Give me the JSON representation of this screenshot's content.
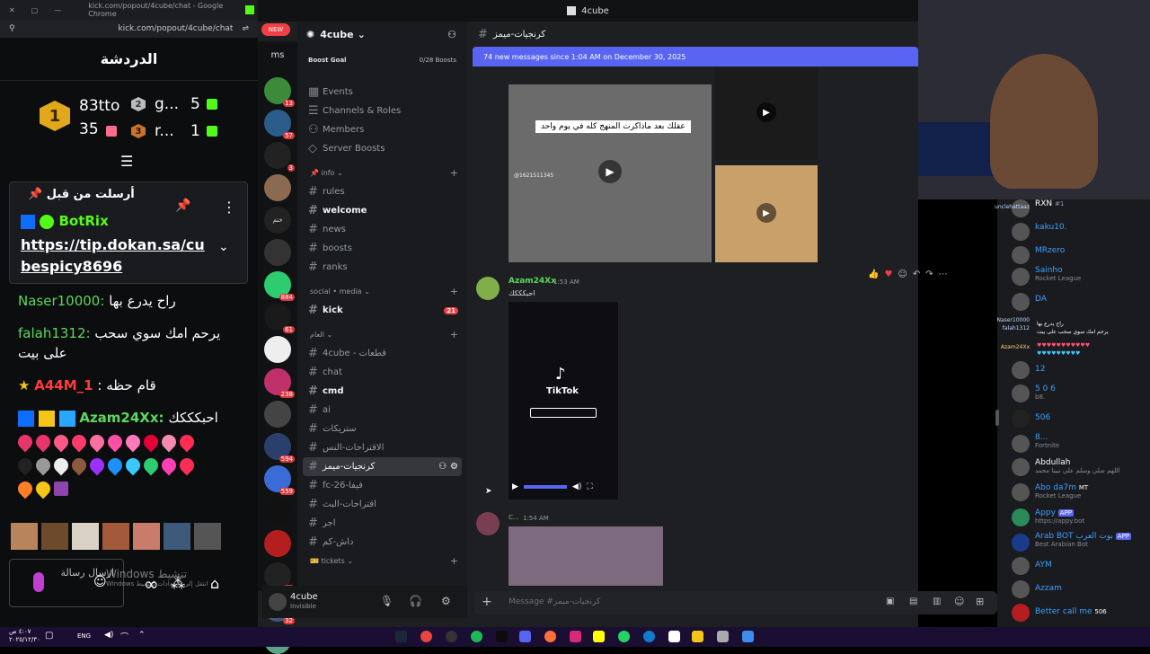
{
  "kick": {
    "window_title": "kick.com/popout/4cube/chat - Google Chrome",
    "url": "kick.com/popout/4cube/chat",
    "chat_title": "الدردشة",
    "leaderboard": [
      {
        "rank": "1",
        "name": "83tto",
        "count": ""
      },
      {
        "rank": "2",
        "name": "g...",
        "count": "5"
      },
      {
        "rank": "",
        "name": "",
        "count": "35"
      },
      {
        "rank": "3",
        "name": "r...",
        "count": "1"
      }
    ],
    "pinned": {
      "header": "أرسلت من قبل",
      "user": "BotRix",
      "link": "https://tip.dokan.sa/cubespicy8696"
    },
    "messages": [
      {
        "user": "Naser10000:",
        "text": "راح يدرع بها",
        "color": "#5bd85b"
      },
      {
        "user": "falah1312:",
        "text": "يرحم امك سوي سحب على بيت",
        "color": "#5bd85b"
      },
      {
        "user": "A44M_1",
        "text": ": قام حظه",
        "color": "#ff3b3b"
      },
      {
        "user": "Azam24Xx:",
        "text": "احبكككك",
        "color": "#5bd85b"
      }
    ],
    "send_label": "ارسال رسالة",
    "windows_watermark": "Windows تنشيط",
    "windows_sub": "Windows انتقل إلى الإعدادات لتنشيط"
  },
  "discord": {
    "top_title": "4cube",
    "server_name": "4cube",
    "new_badge": "NEW",
    "ms_label": "ms",
    "boost_goal": "Boost Goal",
    "boosts": "0/28 Boosts",
    "menu": [
      "Events",
      "Channels & Roles",
      "Members",
      "Server Boosts"
    ],
    "server_badges": [
      "13",
      "57",
      "3",
      "",
      "",
      "",
      "",
      "884",
      "61",
      "",
      "238",
      "",
      "594",
      "559",
      "",
      "",
      "14",
      "32",
      "",
      ""
    ],
    "categories": {
      "info": "info",
      "social": "social • media",
      "general": "العام",
      "tickets": "tickets"
    },
    "channels_info": [
      "rules",
      "welcome",
      "news",
      "boosts",
      "ranks"
    ],
    "channels_social": [
      "kick"
    ],
    "kick_badge": "21",
    "channels_general": [
      "4cube - قطعات",
      "chat",
      "cmd",
      "ai",
      "ستريكات",
      "الاقتراحات-النس",
      "كرنجيات-ميمز",
      "fc-26-فيفا",
      "اقتراحات-البث",
      "اجر",
      "داش-كم"
    ],
    "active_channel": "كرنجيات-ميمز",
    "current_channel_header": "كرنجيات-ميمز",
    "new_messages_bar": "74 new messages since 1:04 AM on December 30, 2025",
    "video_caption": "عقلك بعد ماذاكرت المنهج كله في يوم واحد",
    "tiktok_id": "@1621511345",
    "msg1_author": "Azam24Xx",
    "msg1_time": "1:53 AM",
    "msg1_text": "احبكككك",
    "tiktok_label": "TikTok",
    "msg2_author": "C...",
    "msg2_time": "1:54 AM",
    "composer_placeholder": "Message #كرنجيات-ميمز",
    "user_name": "4cube",
    "user_status": "Invisible"
  },
  "right_chat": [
    {
      "name": "RXN",
      "tag": "#1",
      "sub": ""
    },
    {
      "name": "kaku10.",
      "sub": ""
    },
    {
      "name": "MRzero",
      "sub": ""
    },
    {
      "name": "Sainho",
      "sub": "Rocket League"
    },
    {
      "name": "DA",
      "sub": ""
    },
    {
      "name": "12",
      "sub": ""
    },
    {
      "name": "5 0 6",
      "sub": "b8."
    },
    {
      "name": "506",
      "sub": ""
    },
    {
      "name": "8...",
      "sub": "Fortnite"
    },
    {
      "name": "Abdullah",
      "sub": "اللهم صلي وسلم على نبينا محمد"
    },
    {
      "name": "Abo da7m",
      "tag": "MT",
      "sub": "Rocket League"
    },
    {
      "name": "Appy",
      "tag": "APP",
      "sub": "https://appy.bot"
    },
    {
      "name": "Arab BOT بوت العرب",
      "tag": "APP",
      "sub": "Best Arabian Bot"
    },
    {
      "name": "AYM",
      "sub": ""
    },
    {
      "name": "Azzam",
      "sub": ""
    },
    {
      "name": "Better call me",
      "tag": "506",
      "sub": ""
    }
  ],
  "overlay_chat": [
    {
      "name": "unclehattaaz",
      "text": ""
    },
    {
      "name": "Naser10000",
      "text": "راح يدرع بها"
    },
    {
      "name": "falah1312",
      "text": "يرحم امك سوي سحب على بيت"
    },
    {
      "name": "Azam24Xx",
      "text": "احبكككك"
    }
  ],
  "taskbar": {
    "time": "٤:٠٧ ص",
    "date": "٢٠٢٥/١٢/٣٠",
    "lang": "ENG"
  }
}
